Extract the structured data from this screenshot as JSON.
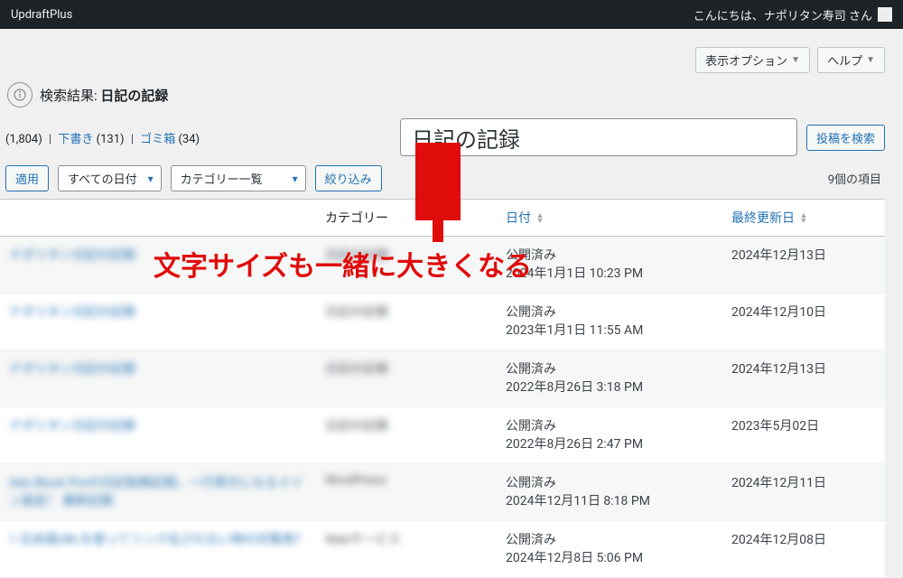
{
  "admin_bar": {
    "plugin_name": "UpdraftPlus",
    "greeting": "こんにちは、ナポリタン寿司 さん"
  },
  "screen_options": {
    "display_options": "表示オプション",
    "help": "ヘルプ"
  },
  "heading": {
    "prefix": "検索結果:",
    "term": "日記の記録"
  },
  "status_links": {
    "all_count": "(1,804)",
    "draft_label": "下書き",
    "draft_count": "(131)",
    "trash_label": "ゴミ箱",
    "trash_count": "(34)"
  },
  "search": {
    "value": "日記の記録",
    "button": "投稿を検索"
  },
  "filters": {
    "apply": "適用",
    "all_dates": "すべての日付",
    "category_list": "カテゴリー一覧",
    "filter_btn": "絞り込み",
    "items_count": "9個の項目"
  },
  "columns": {
    "category": "カテゴリー",
    "date": "日付",
    "modified": "最終更新日"
  },
  "rows": [
    {
      "title": "ナポリタン日記の記録",
      "cat": "日記の記録",
      "status": "公開済み",
      "date": "2024年1月1日 10:23 PM",
      "mod": "2024年12月13日",
      "striped": true
    },
    {
      "title": "ナポリタン日記の記録",
      "cat": "日記の記録",
      "status": "公開済み",
      "date": "2023年1月1日 11:55 AM",
      "mod": "2024年12月10日",
      "striped": false
    },
    {
      "title": "ナポリタン日記の記録",
      "cat": "日記の記録",
      "status": "公開済み",
      "date": "2022年8月26日 3:18 PM",
      "mod": "2024年12月13日",
      "striped": true
    },
    {
      "title": "ナポリタン日記の記録",
      "cat": "日記の記録",
      "status": "公開済み",
      "date": "2022年8月26日 2:47 PM",
      "mod": "2023年5月02日",
      "striped": false
    },
    {
      "title": "Ads Block Proの日記投稿記録。一行表示になるメイン設定！ 最新記録",
      "cat": "WordPress",
      "status": "公開済み",
      "date": "2024年12月11日 8:18 PM",
      "mod": "2024年12月11日",
      "striped": true
    },
    {
      "title": "1 日本語URLを使ってリンク化されない時の対策用？",
      "cat": "Webサービス",
      "status": "公開済み",
      "date": "2024年12月8日 5:06 PM",
      "mod": "2024年12月08日",
      "striped": false
    }
  ],
  "annotation": "文字サイズも一緒に大きくなる"
}
